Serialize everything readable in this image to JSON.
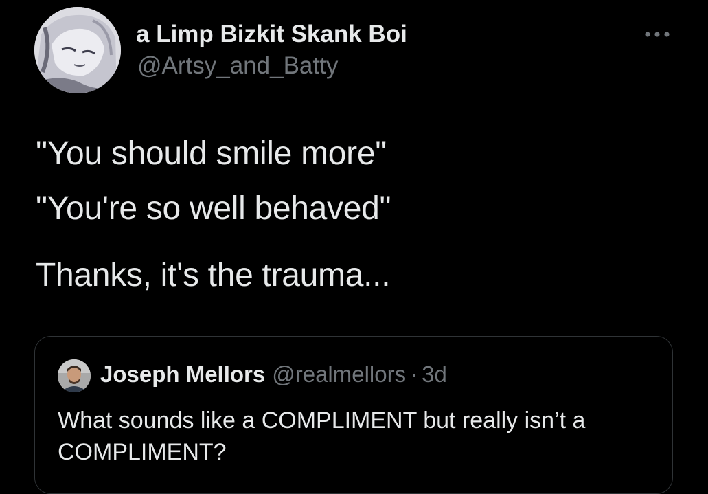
{
  "author": {
    "display_name": "a Limp Bizkit Skank Boi",
    "handle": "@Artsy_and_Batty",
    "avatar_icon": "profile-illustration-avatar"
  },
  "more_icon": "more-horizontal-icon",
  "tweet": {
    "lines": [
      "\"You should smile more\"",
      "\"You're so well behaved\"",
      "Thanks, it's the trauma..."
    ]
  },
  "quote": {
    "display_name": "Joseph Mellors",
    "handle": "@realmellors",
    "separator": "·",
    "time": "3d",
    "text": "What sounds like a COMPLIMENT but really isn’t a COMPLIMENT?"
  },
  "colors": {
    "background": "#000000",
    "primary_text": "#e7e9ea",
    "secondary_text": "#71767b",
    "border": "#2f3336"
  }
}
